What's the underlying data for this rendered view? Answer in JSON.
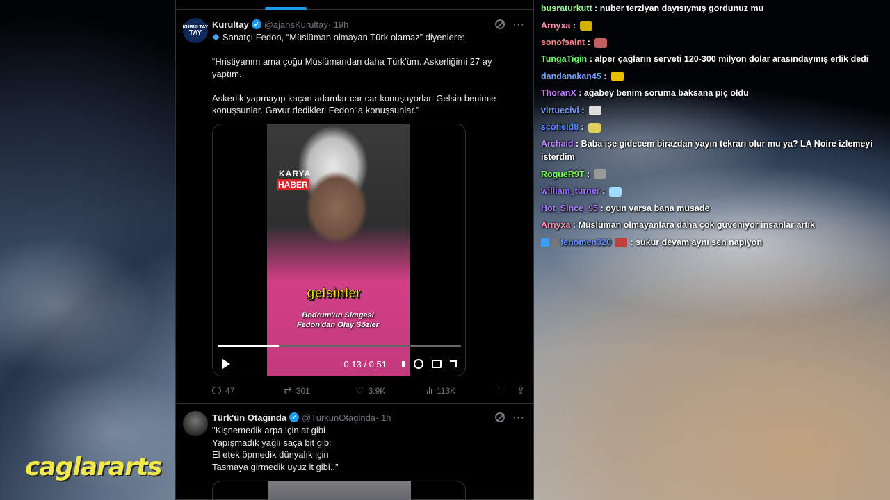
{
  "tweets": [
    {
      "avatar_text": [
        "KURULTAY",
        "TAY"
      ],
      "name": "Kurultay",
      "handle": "@ajansKurultay",
      "time": "· 19h",
      "lead": "Sanatçı Fedon, “Müslüman olmayan Türk olamaz” diyenlere:",
      "paragraphs": [
        "“Hristiyanım ama çoğu Müslümandan daha Türk'üm. Askerliğimi 27 ay yaptım.",
        "Askerlik yapmayıp kaçan adamlar car car konuşuyorlar. Gelsin benimle konuşsunlar. Gavur dedikleri Fedon'la konuşsunlar.”"
      ],
      "video": {
        "brand_top": "KARYA",
        "brand_bottom": "HABER",
        "caption_big": "gelsinler",
        "caption_small": "Bodrum'un Simgesi Fedon'dan Olay Sözler",
        "time": "0:13 / 0:51",
        "progress": 0.25
      },
      "actions": {
        "replies": "47",
        "reposts": "301",
        "likes": "3.9K",
        "views": "113K"
      }
    },
    {
      "name": "Türk'ün Otağında",
      "handle": "@TurkunOtaginda",
      "time": "· 1h",
      "lines": [
        "\"Kişnemedik arpa için at gibi",
        "Yapışmadık yağlı saça bit gibi",
        "El etek öpmedik dünyalık için",
        "Tasmaya girmedik uyuz it gibi..\""
      ]
    }
  ],
  "chat": [
    {
      "user": "busraturkutt",
      "color": "#9aff9a",
      "text": ": nuber terziyan dayısıymış gordunuz mu"
    },
    {
      "user": "Arnyxa",
      "color": "#ff8fb0",
      "text": ":",
      "emote": "#d4b000"
    },
    {
      "user": "sonofsaint",
      "color": "#ff8080",
      "text": ":",
      "emote": "#c06060"
    },
    {
      "user": "TungaTigin",
      "color": "#6cff6c",
      "text": ": alper çağların serveti 120-300 milyon dolar arasındaymış erlik dedi",
      "wrap": true
    },
    {
      "user": "dandanakan45",
      "color": "#6fa0ff",
      "text": ":",
      "emote": "#e8c000"
    },
    {
      "user": "ThoranX",
      "color": "#c77dff",
      "text": ": ağabey benim soruma baksana piç oldu"
    },
    {
      "user": "virtuecivi",
      "color": "#7a9cff",
      "text": ":",
      "emote": "#dddddd"
    },
    {
      "user": "scofield8",
      "color": "#5a8cff",
      "text": ":",
      "emote": "#e0d060"
    },
    {
      "user": "Archaid",
      "color": "#b98cff",
      "text": ": Baba işe gidecem birazdan yayın tekrarı olur mu ya? LA Noire izlemeyi isterdim",
      "wrap": true
    },
    {
      "user": "RogueR9T",
      "color": "#7dff5a",
      "text": ":",
      "emote": "#999999"
    },
    {
      "user": "william_turner",
      "color": "#a070ff",
      "text": ":",
      "emote": "#9fdcff"
    },
    {
      "user": "Hot_Since_95",
      "color": "#b080ff",
      "text": ": oyun varsa bana musade"
    },
    {
      "user": "Arnyxa",
      "color": "#ff8fb0",
      "text": ": Müslüman olmayanlara daha çok güveniyor insanlar artık"
    },
    {
      "user": "fenomen320",
      "color": "#6a8cff",
      "text": ": sukur devam aynı sen napiyon",
      "emote": "#c04040",
      "badges": [
        "#39a0ff",
        "#777777"
      ]
    }
  ],
  "watermark": "caglararts"
}
